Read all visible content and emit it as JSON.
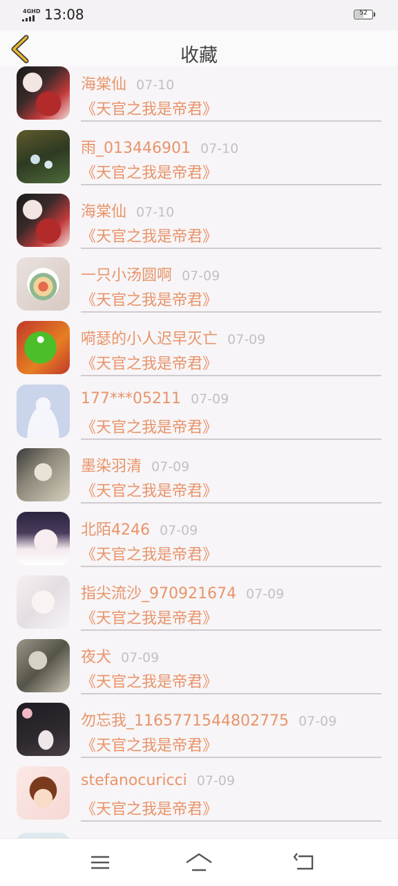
{
  "status_bar": {
    "network": "4GHD",
    "time": "13:08",
    "battery_level": "52",
    "battery_fraction": 0.52
  },
  "header": {
    "back_icon": "chevron-left-icon",
    "title": "收藏"
  },
  "favorites": [
    {
      "name": "海棠仙",
      "date": "07-10",
      "book": "《天官之我是帝君》",
      "avatar": "red-anime-avatar"
    },
    {
      "name": "雨_013446901",
      "date": "07-10",
      "book": "《天官之我是帝君》",
      "avatar": "flower-photo-avatar"
    },
    {
      "name": "海棠仙",
      "date": "07-10",
      "book": "《天官之我是帝君》",
      "avatar": "red-anime-avatar"
    },
    {
      "name": "一只小汤圆啊",
      "date": "07-09",
      "book": "《天官之我是帝君》",
      "avatar": "food-bowl-avatar"
    },
    {
      "name": "嗬瑟的小人迟早灭亡",
      "date": "07-09",
      "book": "《天官之我是帝君》",
      "avatar": "green-monster-avatar"
    },
    {
      "name": "177***05211",
      "date": "07-09",
      "book": "《天官之我是帝君》",
      "avatar": "default-user-avatar"
    },
    {
      "name": "墨染羽清",
      "date": "07-09",
      "book": "《天官之我是帝君》",
      "avatar": "sketch-portrait-avatar"
    },
    {
      "name": "北陌4246",
      "date": "07-09",
      "book": "《天官之我是帝君》",
      "avatar": "anime-boy-avatar"
    },
    {
      "name": "指尖流沙_970921674",
      "date": "07-09",
      "book": "《天官之我是帝君》",
      "avatar": "white-hair-avatar"
    },
    {
      "name": "夜犬",
      "date": "07-09",
      "book": "《天官之我是帝君》",
      "avatar": "ancient-couple-avatar"
    },
    {
      "name": "勿忘我_1165771544802775",
      "date": "07-09",
      "book": "《天官之我是帝君》",
      "avatar": "night-lady-avatar"
    },
    {
      "name": "stefanocuricci",
      "date": "07-09",
      "book": "《天官之我是帝君》",
      "avatar": "cartoon-girl-avatar"
    }
  ],
  "colors": {
    "accent": "#e8946a",
    "date": "#c3c0c3",
    "back_icon": "#e0a81e"
  },
  "system_nav": {
    "menu_icon": "menu-icon",
    "home_icon": "home-icon",
    "back_icon": "return-icon"
  }
}
